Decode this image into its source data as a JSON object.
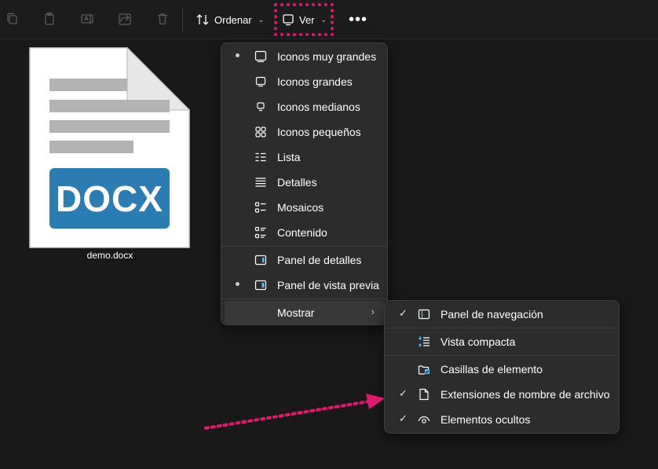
{
  "toolbar": {
    "sort_label": "Ordenar",
    "view_label": "Ver"
  },
  "file": {
    "name": "demo.docx",
    "badge": "DOCX",
    "badge_color": "#2b7cb3"
  },
  "view_menu": {
    "items": [
      {
        "label": "Iconos muy grandes",
        "icon": "monitor-large-icon",
        "selected": true
      },
      {
        "label": "Iconos grandes",
        "icon": "monitor-icon",
        "selected": false
      },
      {
        "label": "Iconos medianos",
        "icon": "monitor-small-icon",
        "selected": false
      },
      {
        "label": "Iconos pequeños",
        "icon": "grid-icon",
        "selected": false
      },
      {
        "label": "Lista",
        "icon": "list-icon",
        "selected": false
      },
      {
        "label": "Detalles",
        "icon": "details-icon",
        "selected": false
      },
      {
        "label": "Mosaicos",
        "icon": "tiles-icon",
        "selected": false
      },
      {
        "label": "Contenido",
        "icon": "content-icon",
        "selected": false
      },
      {
        "label": "Panel de detalles",
        "icon": "details-pane-icon",
        "selected": false
      },
      {
        "label": "Panel de vista previa",
        "icon": "preview-pane-icon",
        "selected": true
      },
      {
        "label": "Mostrar",
        "icon": "",
        "selected": false
      }
    ]
  },
  "show_submenu": {
    "items": [
      {
        "label": "Panel de navegación",
        "icon": "navigation-pane-icon",
        "checked": true
      },
      {
        "label": "Vista compacta",
        "icon": "compact-view-icon",
        "checked": false
      },
      {
        "label": "Casillas de elemento",
        "icon": "item-checkbox-icon",
        "checked": false
      },
      {
        "label": "Extensiones de nombre de archivo",
        "icon": "file-extension-icon",
        "checked": true
      },
      {
        "label": "Elementos ocultos",
        "icon": "eye-icon",
        "checked": true
      }
    ]
  },
  "colors": {
    "highlight": "#e4176e",
    "accent": "#4cc2ff"
  }
}
